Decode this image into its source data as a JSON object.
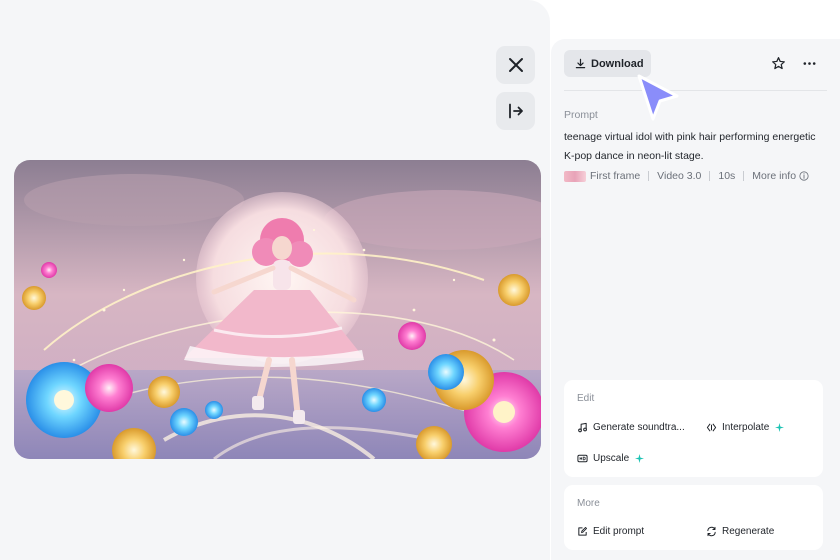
{
  "left_toolbar": {
    "close_icon": "close-icon",
    "exit_icon": "arrow-right-to-line-icon"
  },
  "header": {
    "download_label": "Download",
    "favorite_icon": "star-icon",
    "more_icon": "more-horizontal-icon"
  },
  "prompt": {
    "label": "Prompt",
    "text": "teenage virtual idol with pink hair performing energetic K-pop dance in neon-lit stage.",
    "meta": {
      "first_frame": "First frame",
      "model": "Video 3.0",
      "duration": "10s",
      "more_info": "More info"
    }
  },
  "edit_card": {
    "title": "Edit",
    "actions": [
      {
        "label": "Generate soundtra...",
        "icon": "music-note-icon",
        "pro": false
      },
      {
        "label": "Interpolate",
        "icon": "interpolate-icon",
        "pro": true
      },
      {
        "label": "Upscale",
        "icon": "hd-icon",
        "pro": true
      }
    ]
  },
  "more_card": {
    "title": "More",
    "actions": [
      {
        "label": "Edit prompt",
        "icon": "edit-prompt-icon"
      },
      {
        "label": "Regenerate",
        "icon": "refresh-icon"
      }
    ]
  },
  "colors": {
    "accent_sparkle": "#1ec3b4",
    "cursor": "#8a8dfa",
    "panel_bg": "#f5f6f8"
  }
}
